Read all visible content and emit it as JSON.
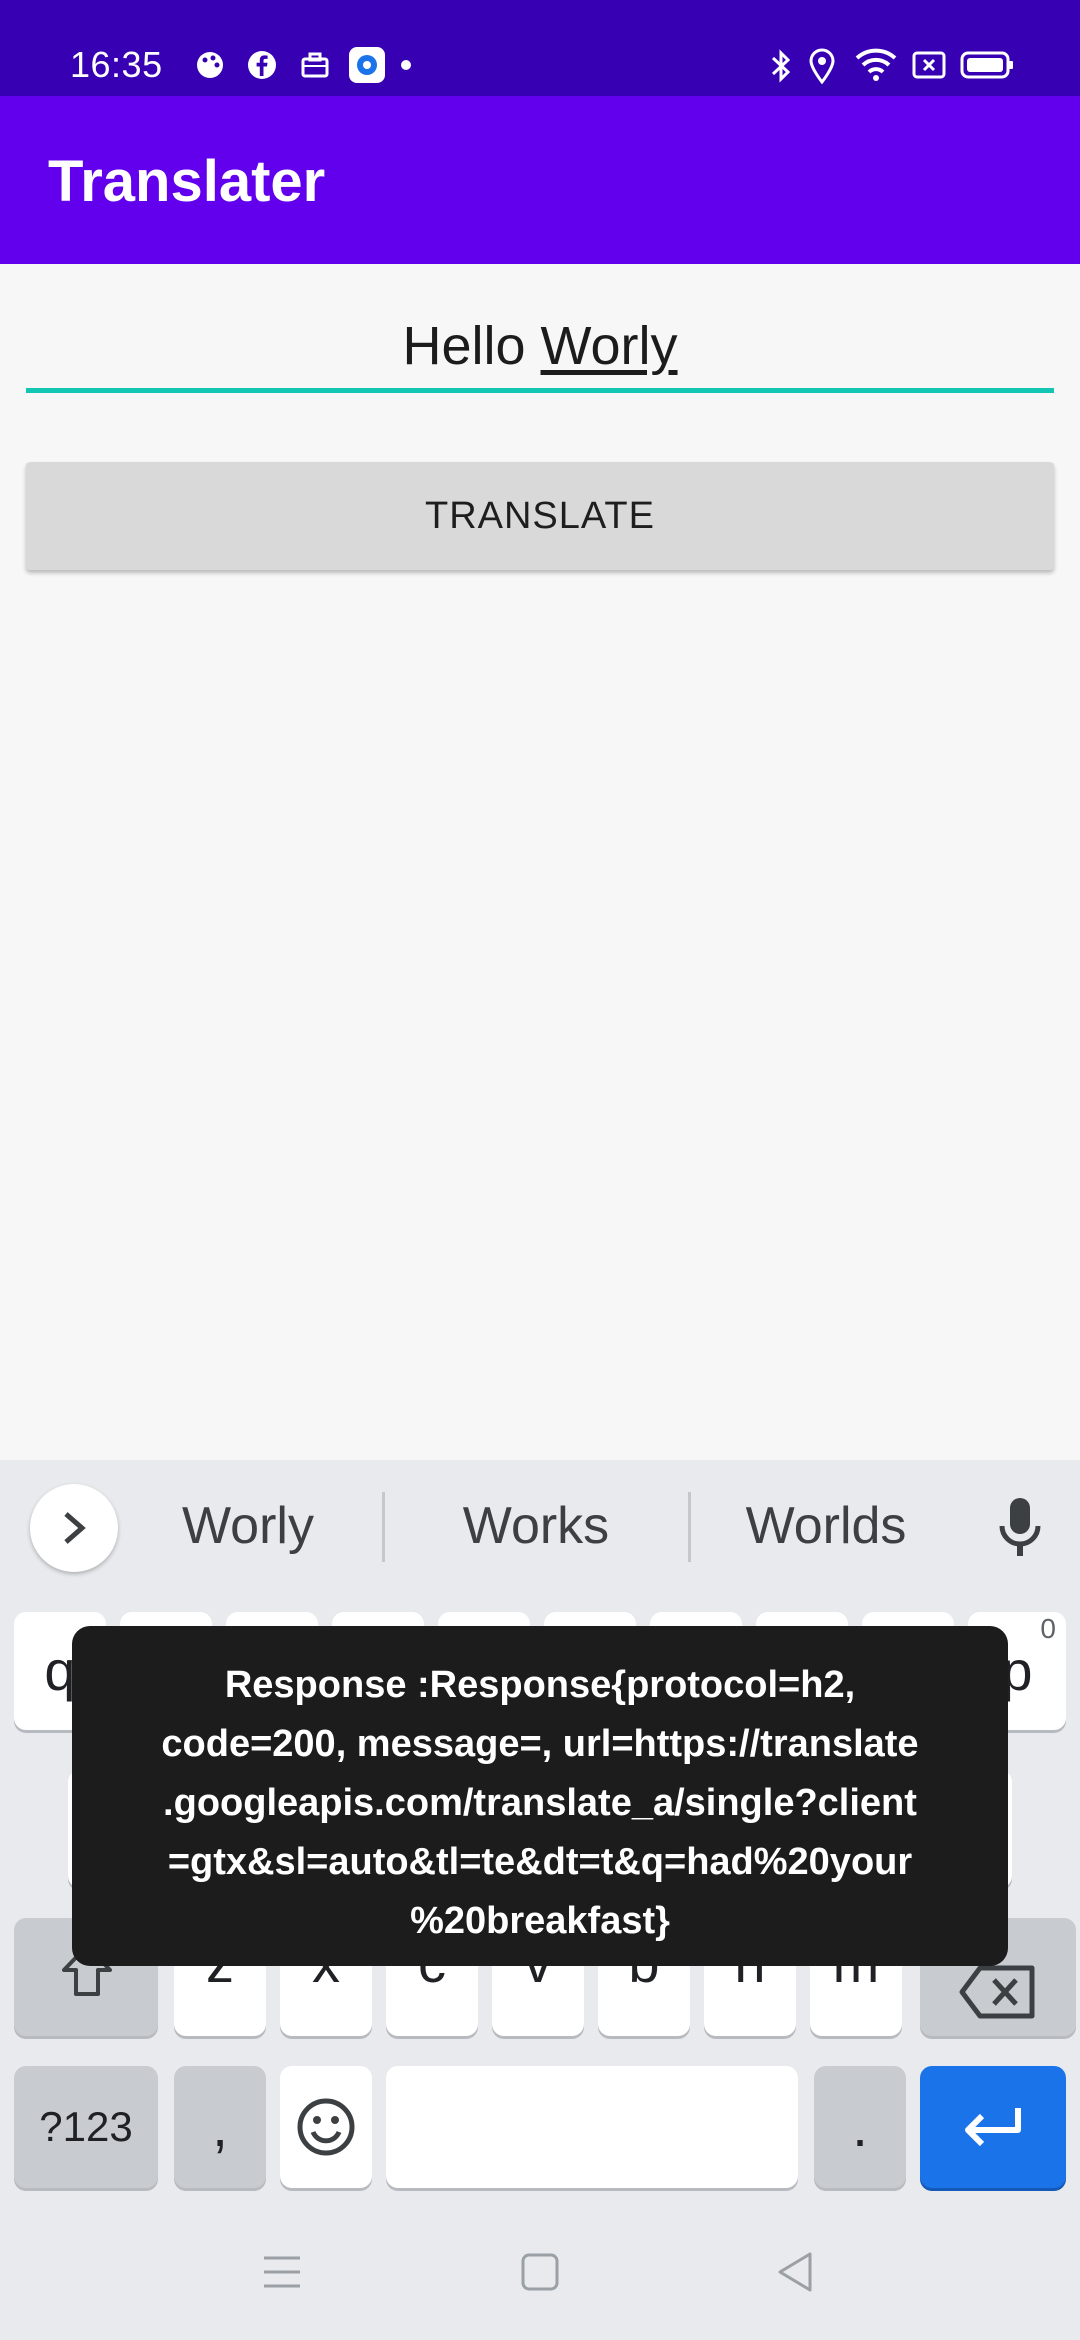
{
  "status_bar": {
    "time": "16:35",
    "left_icons": [
      "palette-icon",
      "facebook-icon",
      "briefcase-icon",
      "app-notification-icon",
      "dot-icon"
    ],
    "right_icons": [
      "bluetooth-icon",
      "location-icon",
      "wifi-icon",
      "sim-icon",
      "battery-icon"
    ]
  },
  "app_bar": {
    "title": "Translater"
  },
  "input": {
    "prefix": "Hello ",
    "underlined_word": "Worly"
  },
  "translate_button": {
    "label": "TRANSLATE"
  },
  "keyboard": {
    "suggestions": [
      "Worly",
      "Works",
      "Worlds"
    ],
    "row1_visible": {
      "left_letter": "q",
      "right_letter": "p",
      "right_number": "0"
    },
    "row3_letters": [
      "z",
      "x",
      "c",
      "v",
      "b",
      "n",
      "m"
    ],
    "bottom_row": {
      "symbols_label": "?123",
      "comma": ",",
      "period": "."
    },
    "colors": {
      "enter": "#1a73e8",
      "background": "#e8eaed"
    }
  },
  "toast": {
    "lines": [
      "Response :Response{protocol=h2,",
      "code=200, message=, url=https://translate",
      ".googleapis.com/translate_a/single?client",
      "=gtx&sl=auto&tl=te&dt=t&q=had%20your",
      "%20breakfast}"
    ]
  }
}
